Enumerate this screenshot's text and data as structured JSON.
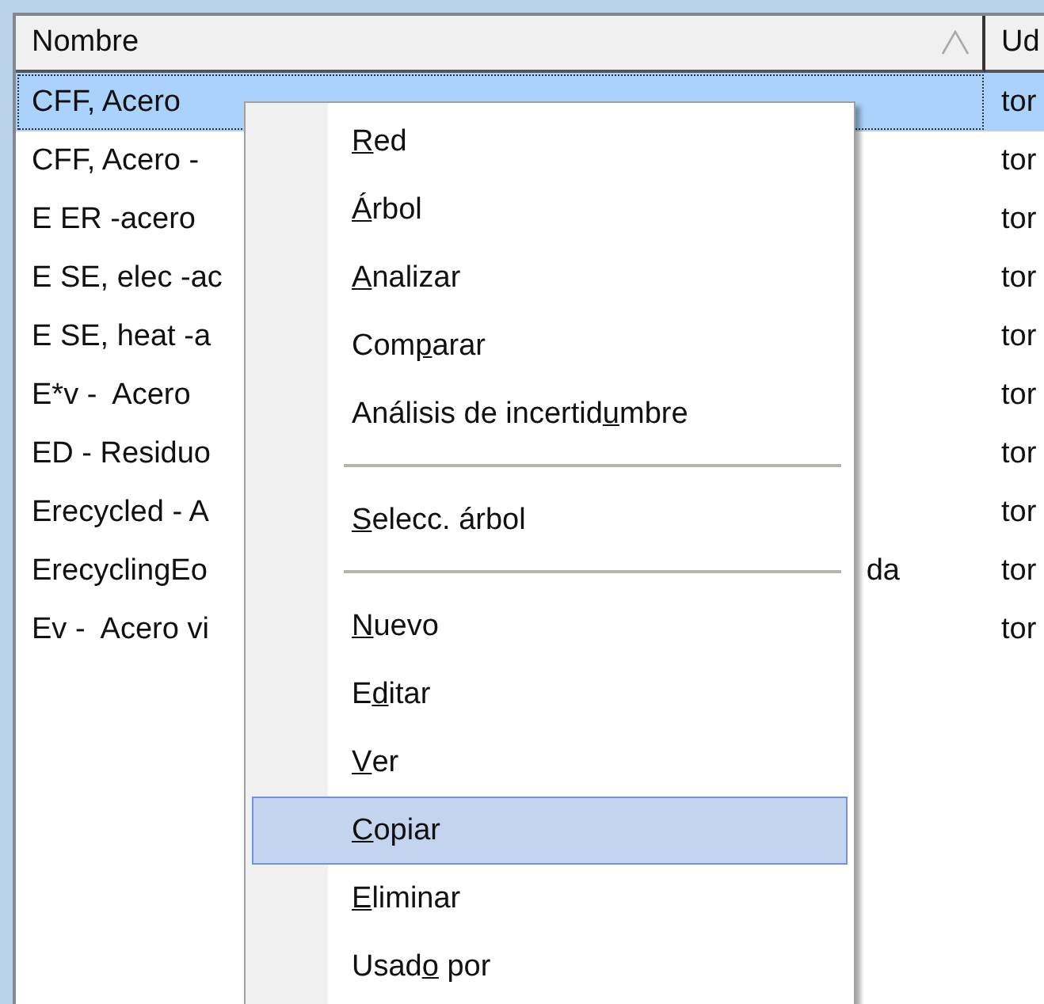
{
  "table": {
    "columns": [
      {
        "label": "Nombre",
        "sorted": true
      },
      {
        "label": "Ud",
        "sorted": false
      }
    ],
    "rows": [
      {
        "name": "CFF, Acero",
        "unit": "tor",
        "selected": true
      },
      {
        "name": "CFF, Acero -",
        "unit": "tor",
        "selected": false
      },
      {
        "name": "E ER -acero",
        "unit": "tor",
        "selected": false
      },
      {
        "name": "E SE, elec -ac",
        "unit": "tor",
        "selected": false
      },
      {
        "name": "E SE, heat -a",
        "unit": "tor",
        "selected": false
      },
      {
        "name": "E*v -  Acero",
        "unit": "tor",
        "selected": false
      },
      {
        "name": "ED - Residuo",
        "unit": "tor",
        "selected": false
      },
      {
        "name": "Erecycled - A",
        "unit": "tor",
        "selected": false
      },
      {
        "name": "ErecyclingEo",
        "name_tail": "da",
        "unit": "tor",
        "selected": false
      },
      {
        "name": "Ev -  Acero vi",
        "unit": "tor",
        "selected": false
      }
    ]
  },
  "context_menu": {
    "items": [
      {
        "kind": "item",
        "key": "R",
        "after": "ed",
        "selected": false
      },
      {
        "kind": "item",
        "key": "Á",
        "after": "rbol",
        "selected": false
      },
      {
        "kind": "item",
        "key": "A",
        "after": "nalizar",
        "selected": false
      },
      {
        "kind": "item",
        "before": "Com",
        "key": "p",
        "after": "arar",
        "selected": false
      },
      {
        "kind": "item",
        "before": "Análisis de incertid",
        "key": "u",
        "after": "mbre",
        "selected": false
      },
      {
        "kind": "separator"
      },
      {
        "kind": "item",
        "key": "S",
        "after": "elecc. árbol",
        "selected": false
      },
      {
        "kind": "separator"
      },
      {
        "kind": "item",
        "key": "N",
        "after": "uevo",
        "selected": false
      },
      {
        "kind": "item",
        "before": "E",
        "key": "d",
        "after": "itar",
        "selected": false
      },
      {
        "kind": "item",
        "key": "V",
        "after": "er",
        "selected": false
      },
      {
        "kind": "item",
        "key": "C",
        "after": "opiar",
        "selected": true
      },
      {
        "kind": "item",
        "key": "E",
        "after": "liminar",
        "selected": false
      },
      {
        "kind": "item",
        "before": "Usad",
        "key": "o",
        "after": " por",
        "selected": false
      }
    ]
  }
}
